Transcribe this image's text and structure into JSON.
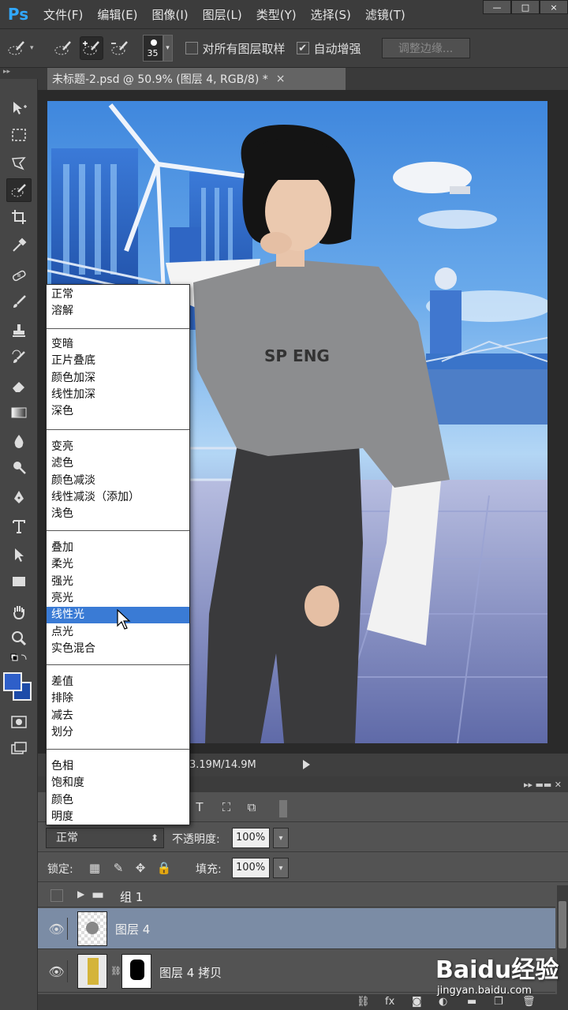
{
  "app": {
    "logo": "Ps",
    "accent": "#31a8ff"
  },
  "menubar": {
    "items": [
      "文件(F)",
      "编辑(E)",
      "图像(I)",
      "图层(L)",
      "类型(Y)",
      "选择(S)",
      "滤镜(T)"
    ]
  },
  "window_buttons": {
    "minimize": "—",
    "maximize": "□",
    "close": "×"
  },
  "options": {
    "brush_size": "35",
    "sample_all_layers_label": "对所有图层取样",
    "sample_all_layers_checked": false,
    "auto_enhance_label": "自动增强",
    "auto_enhance_checked": true,
    "refine_edge_label": "调整边缘..."
  },
  "document": {
    "tab_title": "未标题-2.psd @ 50.9% (图层 4, RGB/8) *",
    "close": "×",
    "doc_size": "3.19M/14.9M"
  },
  "blend_menu": {
    "groups": [
      [
        "正常",
        "溶解"
      ],
      [
        "变暗",
        "正片叠底",
        "颜色加深",
        "线性加深",
        "深色"
      ],
      [
        "变亮",
        "滤色",
        "颜色减淡",
        "线性减淡（添加）",
        "浅色"
      ],
      [
        "叠加",
        "柔光",
        "强光",
        "亮光",
        "线性光",
        "点光",
        "实色混合"
      ],
      [
        "差值",
        "排除",
        "减去",
        "划分"
      ],
      [
        "色相",
        "饱和度",
        "颜色",
        "明度"
      ]
    ],
    "highlighted": "线性光",
    "highlight_color": "#3a7bd5"
  },
  "layers_panel": {
    "blend_mode": "正常",
    "opacity_label": "不透明度:",
    "opacity_value": "100%",
    "lock_label": "锁定:",
    "fill_label": "填充:",
    "fill_value": "100%",
    "layers": [
      {
        "name": "组 1",
        "type": "group",
        "visible": false
      },
      {
        "name": "图层 4",
        "type": "layer",
        "visible": true,
        "selected": true
      },
      {
        "name": "图层 4 拷贝",
        "type": "layer-with-mask",
        "visible": true
      }
    ],
    "selected_color": "#7b8ca5"
  },
  "watermark": {
    "text": "Baidu经验",
    "url": "jingyan.baidu.com"
  }
}
